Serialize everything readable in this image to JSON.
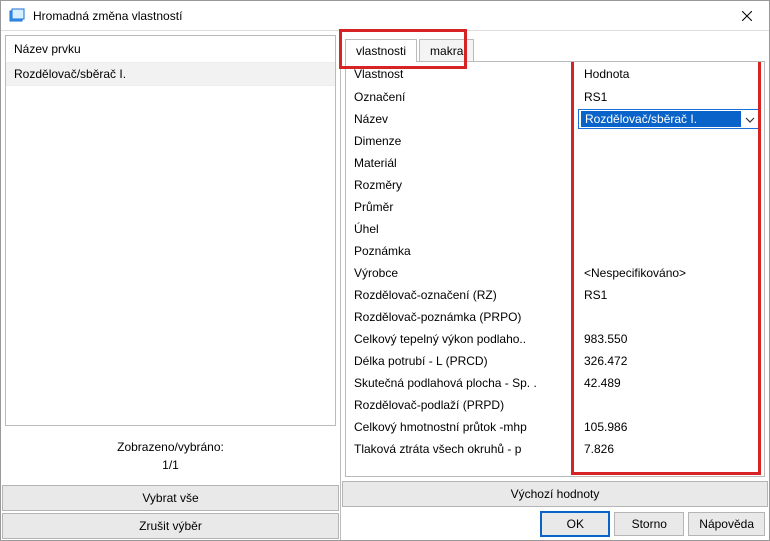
{
  "window": {
    "title": "Hromadná změna vlastností"
  },
  "left": {
    "header": "Název prvku",
    "items": [
      "Rozdělovač/sběrač I."
    ],
    "statusLabel": "Zobrazeno/vybráno:",
    "statusCount": "1/1",
    "buttons": {
      "selectAll": "Vybrat vše",
      "clearSel": "Zrušit výběr"
    }
  },
  "right": {
    "tabs": {
      "props": "vlastnosti",
      "macros": "makra"
    },
    "columns": {
      "prop": "Vlastnost",
      "val": "Hodnota"
    },
    "rows": [
      {
        "name": "Označení",
        "value": "RS1"
      },
      {
        "name": "Název",
        "combo": "Rozdělovač/sběrač I."
      },
      {
        "name": "Dimenze",
        "value": ""
      },
      {
        "name": "Materiál",
        "value": ""
      },
      {
        "name": "Rozměry",
        "value": ""
      },
      {
        "name": "Průměr",
        "value": ""
      },
      {
        "name": "Úhel",
        "value": ""
      },
      {
        "name": "Poznámka",
        "value": ""
      },
      {
        "name": "Výrobce",
        "value": "<Nespecifikováno>"
      },
      {
        "name": "Rozdělovač-označení (RZ)",
        "value": "RS1"
      },
      {
        "name": "Rozdělovač-poznámka (PRPO)",
        "value": ""
      },
      {
        "name": "Celkový tepelný výkon podlaho..",
        "value": "983.550"
      },
      {
        "name": "Délka potrubí - L (PRCD)",
        "value": "326.472"
      },
      {
        "name": "Skutečná podlahová plocha - Sp. .",
        "value": "42.489"
      },
      {
        "name": "Rozdělovač-podlaží (PRPD)",
        "value": ""
      },
      {
        "name": "Celkový hmotnostní průtok -mhp",
        "value": "105.986"
      },
      {
        "name": "Tlaková ztráta všech okruhů - p",
        "value": "7.826"
      }
    ],
    "defaultsBtn": "Výchozí hodnoty"
  },
  "footer": {
    "ok": "OK",
    "cancel": "Storno",
    "help": "Nápověda"
  }
}
